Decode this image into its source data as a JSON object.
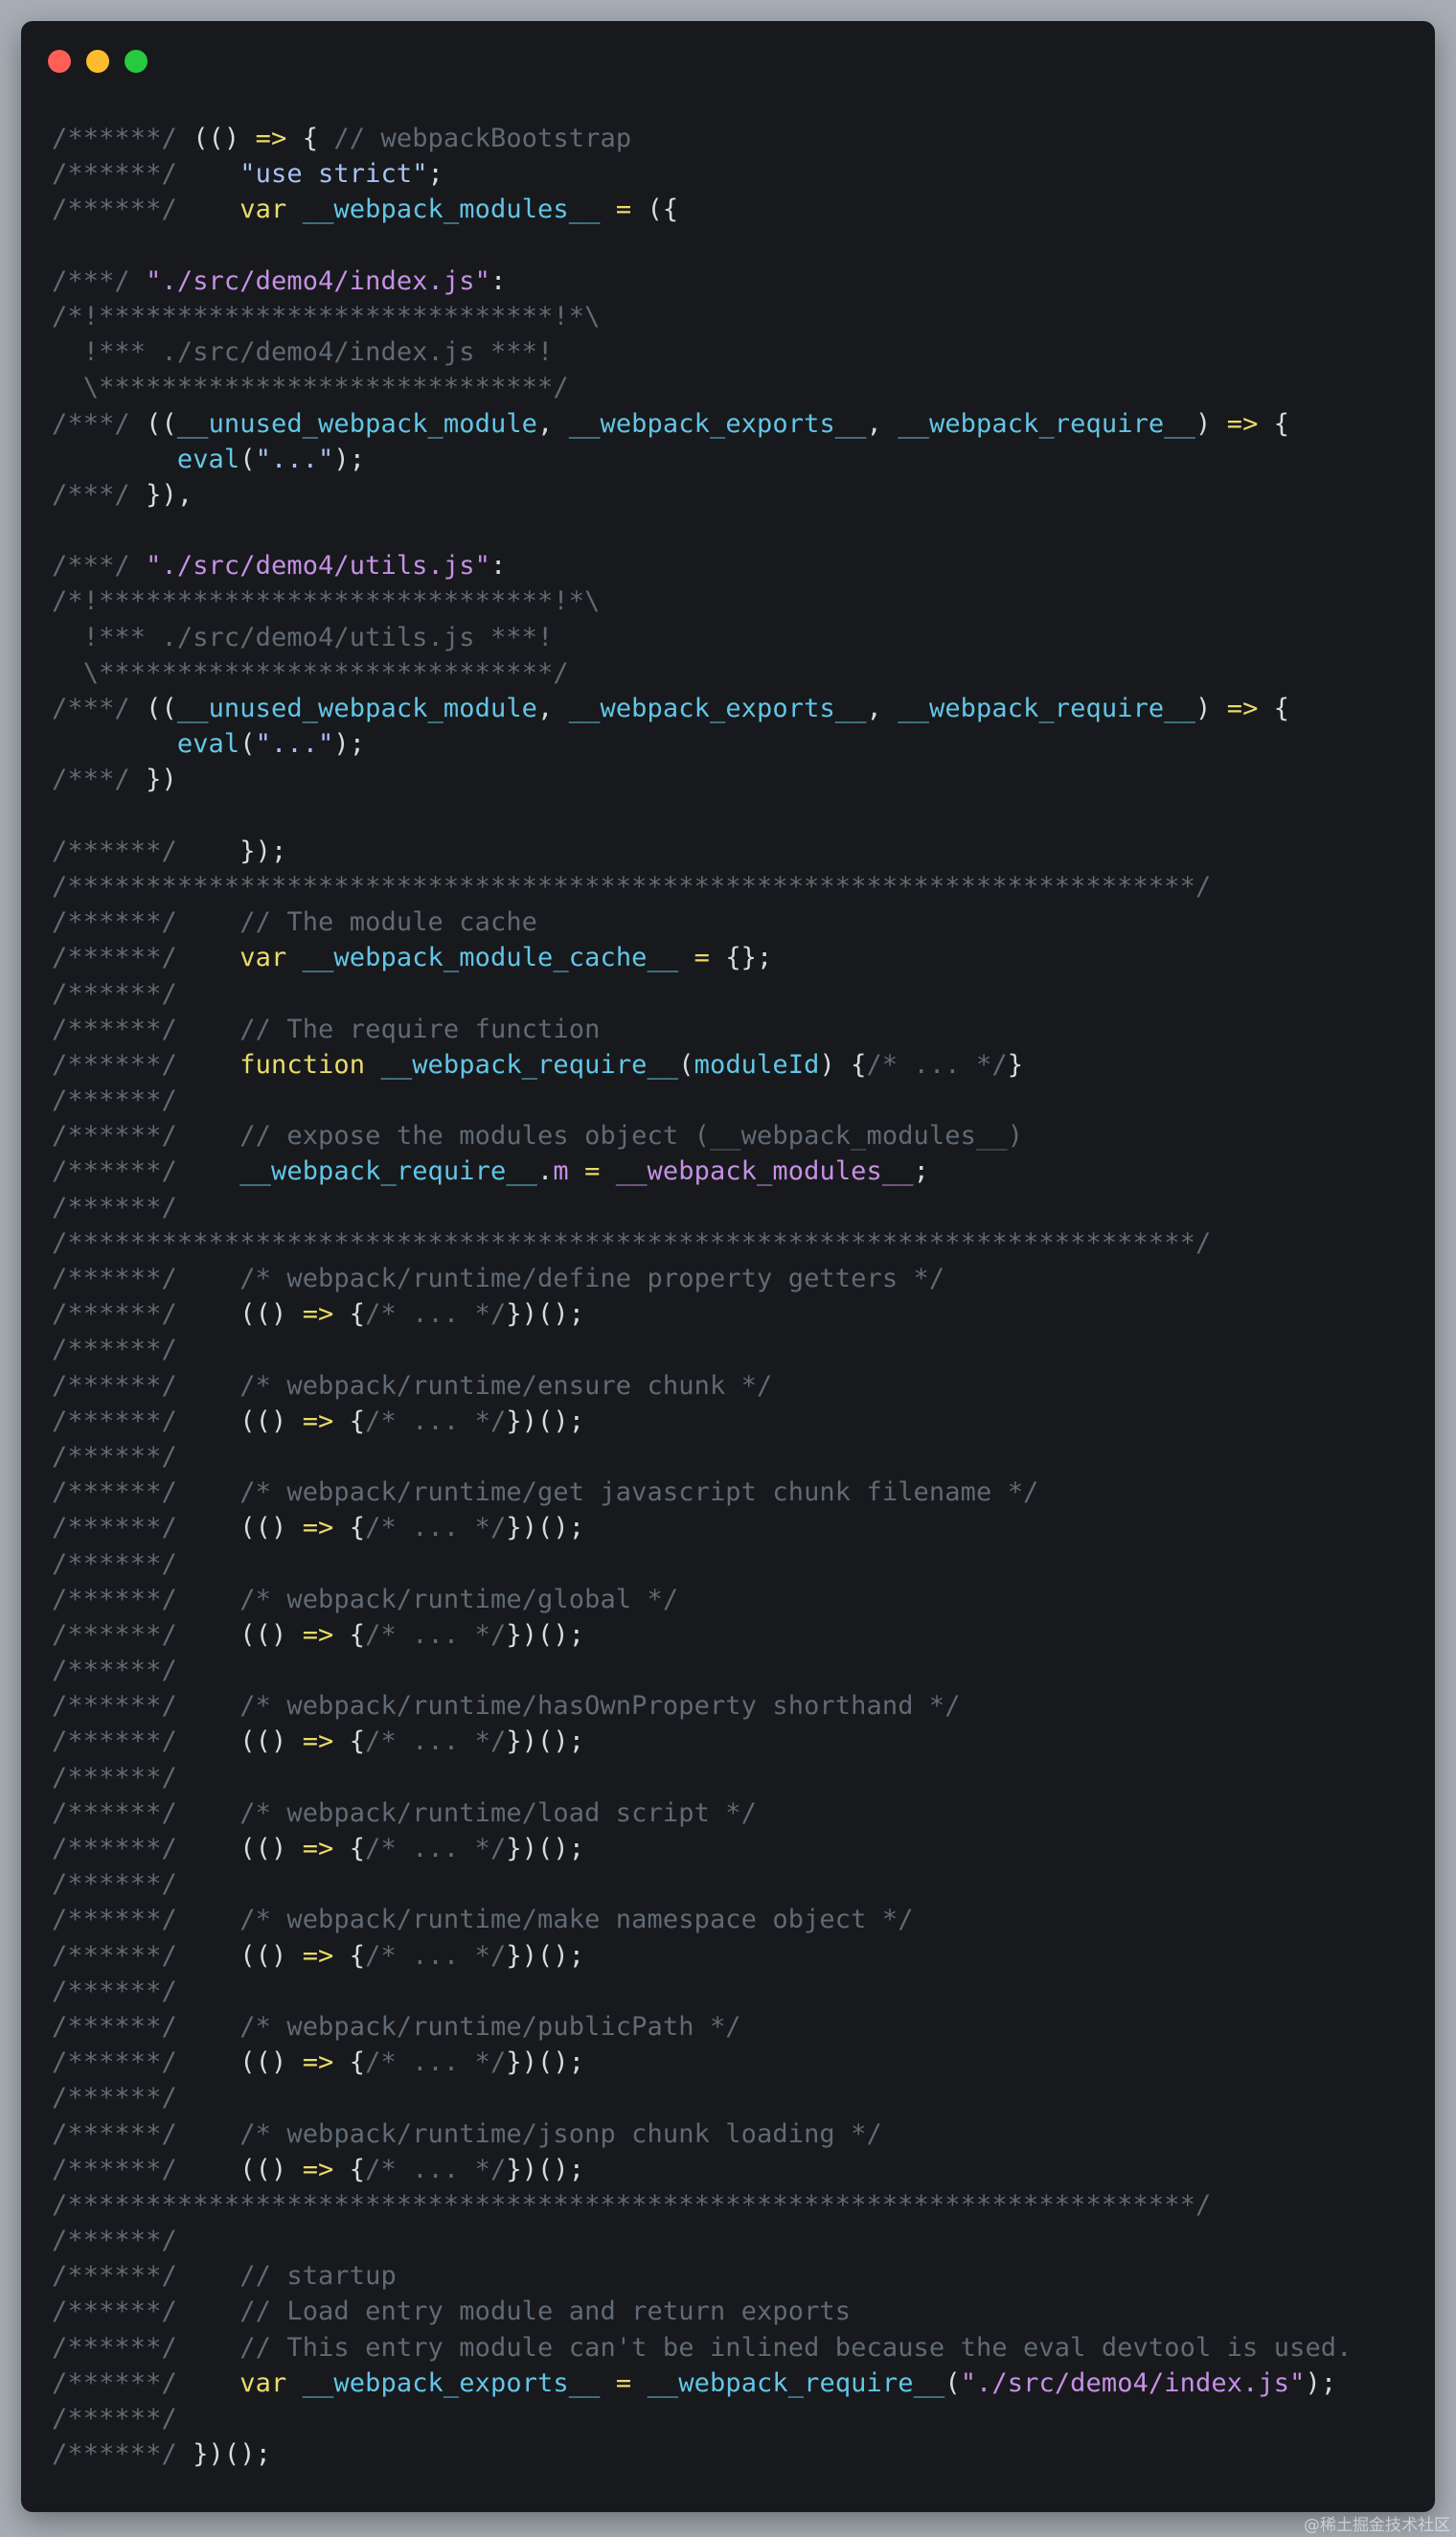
{
  "window": {
    "controls": [
      {
        "name": "close",
        "color": "#ff5f56"
      },
      {
        "name": "minimize",
        "color": "#ffbd2e"
      },
      {
        "name": "maximize",
        "color": "#27c93f"
      }
    ]
  },
  "code": {
    "lines": [
      [
        [
          "c",
          "/******/ "
        ],
        [
          "pl",
          "(() "
        ],
        [
          "o",
          "=>"
        ],
        [
          "pl",
          " { "
        ],
        [
          "c",
          "// webpackBootstrap"
        ]
      ],
      [
        [
          "c",
          "/******/ "
        ],
        [
          "pl",
          "   "
        ],
        [
          "s",
          "\"use strict\""
        ],
        [
          "pl",
          ";"
        ]
      ],
      [
        [
          "c",
          "/******/ "
        ],
        [
          "pl",
          "   "
        ],
        [
          "k",
          "var"
        ],
        [
          "pl",
          " "
        ],
        [
          "g",
          "__webpack_modules__"
        ],
        [
          "pl",
          " "
        ],
        [
          "o",
          "="
        ],
        [
          "pl",
          " ({"
        ]
      ],
      [],
      [
        [
          "c",
          "/***/ "
        ],
        [
          "str",
          "\"./src/demo4/index.js\""
        ],
        [
          "pl",
          ":"
        ]
      ],
      [
        [
          "c",
          "/*!*****************************!*\\"
        ]
      ],
      [
        [
          "c",
          "  !*** ./src/demo4/index.js ***!"
        ]
      ],
      [
        [
          "c",
          "  \\*****************************/"
        ]
      ],
      [
        [
          "c",
          "/***/ "
        ],
        [
          "pl",
          "(("
        ],
        [
          "g",
          "__unused_webpack_module"
        ],
        [
          "pl",
          ", "
        ],
        [
          "g",
          "__webpack_exports__"
        ],
        [
          "pl",
          ", "
        ],
        [
          "g",
          "__webpack_require__"
        ],
        [
          "pl",
          ") "
        ],
        [
          "o",
          "=>"
        ],
        [
          "pl",
          " {"
        ]
      ],
      [
        [
          "pl",
          "        "
        ],
        [
          "fn",
          "eval"
        ],
        [
          "pl",
          "("
        ],
        [
          "s",
          "\"...\""
        ],
        [
          "pl",
          ");"
        ]
      ],
      [
        [
          "c",
          "/***/ "
        ],
        [
          "pl",
          "}),"
        ]
      ],
      [],
      [
        [
          "c",
          "/***/ "
        ],
        [
          "str",
          "\"./src/demo4/utils.js\""
        ],
        [
          "pl",
          ":"
        ]
      ],
      [
        [
          "c",
          "/*!*****************************!*\\"
        ]
      ],
      [
        [
          "c",
          "  !*** ./src/demo4/utils.js ***!"
        ]
      ],
      [
        [
          "c",
          "  \\*****************************/"
        ]
      ],
      [
        [
          "c",
          "/***/ "
        ],
        [
          "pl",
          "(("
        ],
        [
          "g",
          "__unused_webpack_module"
        ],
        [
          "pl",
          ", "
        ],
        [
          "g",
          "__webpack_exports__"
        ],
        [
          "pl",
          ", "
        ],
        [
          "g",
          "__webpack_require__"
        ],
        [
          "pl",
          ") "
        ],
        [
          "o",
          "=>"
        ],
        [
          "pl",
          " {"
        ]
      ],
      [
        [
          "pl",
          "        "
        ],
        [
          "fn",
          "eval"
        ],
        [
          "pl",
          "("
        ],
        [
          "s",
          "\"...\""
        ],
        [
          "pl",
          ");"
        ]
      ],
      [
        [
          "c",
          "/***/ "
        ],
        [
          "pl",
          "})"
        ]
      ],
      [],
      [
        [
          "c",
          "/******/ "
        ],
        [
          "pl",
          "   });"
        ]
      ],
      [
        [
          "c",
          "/************************************************************************/"
        ]
      ],
      [
        [
          "c",
          "/******/ "
        ],
        [
          "pl",
          "   "
        ],
        [
          "c",
          "// The module cache"
        ]
      ],
      [
        [
          "c",
          "/******/ "
        ],
        [
          "pl",
          "   "
        ],
        [
          "k",
          "var"
        ],
        [
          "pl",
          " "
        ],
        [
          "g",
          "__webpack_module_cache__"
        ],
        [
          "pl",
          " "
        ],
        [
          "o",
          "="
        ],
        [
          "pl",
          " {};"
        ]
      ],
      [
        [
          "c",
          "/******/"
        ]
      ],
      [
        [
          "c",
          "/******/ "
        ],
        [
          "pl",
          "   "
        ],
        [
          "c",
          "// The require function"
        ]
      ],
      [
        [
          "c",
          "/******/ "
        ],
        [
          "pl",
          "   "
        ],
        [
          "k",
          "function"
        ],
        [
          "pl",
          " "
        ],
        [
          "g",
          "__webpack_require__"
        ],
        [
          "pl",
          "("
        ],
        [
          "g",
          "moduleId"
        ],
        [
          "pl",
          ") {"
        ],
        [
          "c",
          "/* ... */"
        ],
        [
          "pl",
          "}"
        ]
      ],
      [
        [
          "c",
          "/******/"
        ]
      ],
      [
        [
          "c",
          "/******/ "
        ],
        [
          "pl",
          "   "
        ],
        [
          "c",
          "// expose the modules object (__webpack_modules__)"
        ]
      ],
      [
        [
          "c",
          "/******/ "
        ],
        [
          "pl",
          "   "
        ],
        [
          "g",
          "__webpack_require__"
        ],
        [
          "pl",
          "."
        ],
        [
          "str",
          "m"
        ],
        [
          "pl",
          " "
        ],
        [
          "o",
          "="
        ],
        [
          "pl",
          " "
        ],
        [
          "str",
          "__webpack_modules__"
        ],
        [
          "pl",
          ";"
        ]
      ],
      [
        [
          "c",
          "/******/"
        ]
      ],
      [
        [
          "c",
          "/************************************************************************/"
        ]
      ],
      [
        [
          "c",
          "/******/ "
        ],
        [
          "pl",
          "   "
        ],
        [
          "c",
          "/* webpack/runtime/define property getters */"
        ]
      ],
      [
        [
          "c",
          "/******/ "
        ],
        [
          "pl",
          "   (() "
        ],
        [
          "o",
          "=>"
        ],
        [
          "pl",
          " {"
        ],
        [
          "c",
          "/* ... */"
        ],
        [
          "pl",
          "})();"
        ]
      ],
      [
        [
          "c",
          "/******/"
        ]
      ],
      [
        [
          "c",
          "/******/ "
        ],
        [
          "pl",
          "   "
        ],
        [
          "c",
          "/* webpack/runtime/ensure chunk */"
        ]
      ],
      [
        [
          "c",
          "/******/ "
        ],
        [
          "pl",
          "   (() "
        ],
        [
          "o",
          "=>"
        ],
        [
          "pl",
          " {"
        ],
        [
          "c",
          "/* ... */"
        ],
        [
          "pl",
          "})();"
        ]
      ],
      [
        [
          "c",
          "/******/"
        ]
      ],
      [
        [
          "c",
          "/******/ "
        ],
        [
          "pl",
          "   "
        ],
        [
          "c",
          "/* webpack/runtime/get javascript chunk filename */"
        ]
      ],
      [
        [
          "c",
          "/******/ "
        ],
        [
          "pl",
          "   (() "
        ],
        [
          "o",
          "=>"
        ],
        [
          "pl",
          " {"
        ],
        [
          "c",
          "/* ... */"
        ],
        [
          "pl",
          "})();"
        ]
      ],
      [
        [
          "c",
          "/******/"
        ]
      ],
      [
        [
          "c",
          "/******/ "
        ],
        [
          "pl",
          "   "
        ],
        [
          "c",
          "/* webpack/runtime/global */"
        ]
      ],
      [
        [
          "c",
          "/******/ "
        ],
        [
          "pl",
          "   (() "
        ],
        [
          "o",
          "=>"
        ],
        [
          "pl",
          " {"
        ],
        [
          "c",
          "/* ... */"
        ],
        [
          "pl",
          "})();"
        ]
      ],
      [
        [
          "c",
          "/******/"
        ]
      ],
      [
        [
          "c",
          "/******/ "
        ],
        [
          "pl",
          "   "
        ],
        [
          "c",
          "/* webpack/runtime/hasOwnProperty shorthand */"
        ]
      ],
      [
        [
          "c",
          "/******/ "
        ],
        [
          "pl",
          "   (() "
        ],
        [
          "o",
          "=>"
        ],
        [
          "pl",
          " {"
        ],
        [
          "c",
          "/* ... */"
        ],
        [
          "pl",
          "})();"
        ]
      ],
      [
        [
          "c",
          "/******/"
        ]
      ],
      [
        [
          "c",
          "/******/ "
        ],
        [
          "pl",
          "   "
        ],
        [
          "c",
          "/* webpack/runtime/load script */"
        ]
      ],
      [
        [
          "c",
          "/******/ "
        ],
        [
          "pl",
          "   (() "
        ],
        [
          "o",
          "=>"
        ],
        [
          "pl",
          " {"
        ],
        [
          "c",
          "/* ... */"
        ],
        [
          "pl",
          "})();"
        ]
      ],
      [
        [
          "c",
          "/******/"
        ]
      ],
      [
        [
          "c",
          "/******/ "
        ],
        [
          "pl",
          "   "
        ],
        [
          "c",
          "/* webpack/runtime/make namespace object */"
        ]
      ],
      [
        [
          "c",
          "/******/ "
        ],
        [
          "pl",
          "   (() "
        ],
        [
          "o",
          "=>"
        ],
        [
          "pl",
          " {"
        ],
        [
          "c",
          "/* ... */"
        ],
        [
          "pl",
          "})();"
        ]
      ],
      [
        [
          "c",
          "/******/"
        ]
      ],
      [
        [
          "c",
          "/******/ "
        ],
        [
          "pl",
          "   "
        ],
        [
          "c",
          "/* webpack/runtime/publicPath */"
        ]
      ],
      [
        [
          "c",
          "/******/ "
        ],
        [
          "pl",
          "   (() "
        ],
        [
          "o",
          "=>"
        ],
        [
          "pl",
          " {"
        ],
        [
          "c",
          "/* ... */"
        ],
        [
          "pl",
          "})();"
        ]
      ],
      [
        [
          "c",
          "/******/"
        ]
      ],
      [
        [
          "c",
          "/******/ "
        ],
        [
          "pl",
          "   "
        ],
        [
          "c",
          "/* webpack/runtime/jsonp chunk loading */"
        ]
      ],
      [
        [
          "c",
          "/******/ "
        ],
        [
          "pl",
          "   (() "
        ],
        [
          "o",
          "=>"
        ],
        [
          "pl",
          " {"
        ],
        [
          "c",
          "/* ... */"
        ],
        [
          "pl",
          "})();"
        ]
      ],
      [
        [
          "c",
          "/************************************************************************/"
        ]
      ],
      [
        [
          "c",
          "/******/"
        ]
      ],
      [
        [
          "c",
          "/******/ "
        ],
        [
          "pl",
          "   "
        ],
        [
          "c",
          "// startup"
        ]
      ],
      [
        [
          "c",
          "/******/ "
        ],
        [
          "pl",
          "   "
        ],
        [
          "c",
          "// Load entry module and return exports"
        ]
      ],
      [
        [
          "c",
          "/******/ "
        ],
        [
          "pl",
          "   "
        ],
        [
          "c",
          "// This entry module can't be inlined because the eval devtool is used."
        ]
      ],
      [
        [
          "c",
          "/******/ "
        ],
        [
          "pl",
          "   "
        ],
        [
          "k",
          "var"
        ],
        [
          "pl",
          " "
        ],
        [
          "g",
          "__webpack_exports__"
        ],
        [
          "pl",
          " "
        ],
        [
          "o",
          "="
        ],
        [
          "pl",
          " "
        ],
        [
          "g",
          "__webpack_require__"
        ],
        [
          "pl",
          "("
        ],
        [
          "str",
          "\"./src/demo4/index.js\""
        ],
        [
          "pl",
          ");"
        ]
      ],
      [
        [
          "c",
          "/******/"
        ]
      ],
      [
        [
          "c",
          "/******/ "
        ],
        [
          "pl",
          "})();"
        ]
      ]
    ]
  },
  "watermark": "@稀土掘金技术社区"
}
